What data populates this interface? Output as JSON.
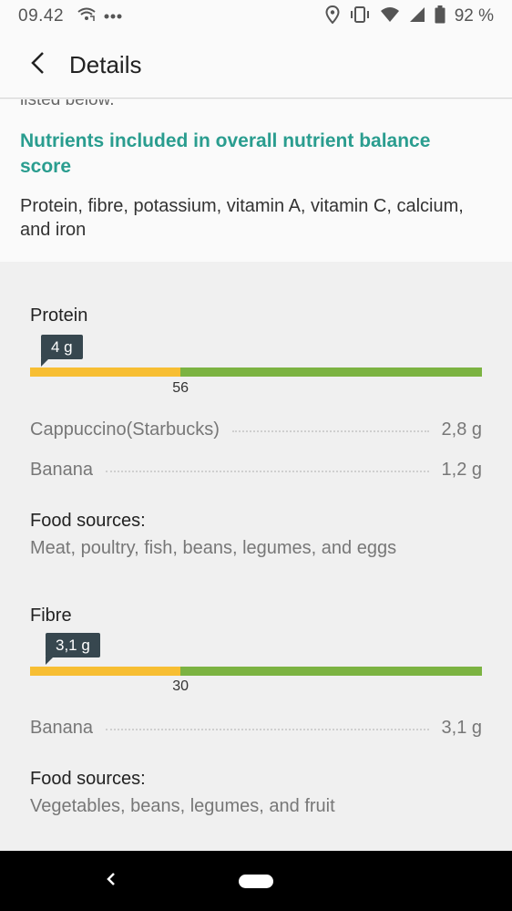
{
  "status_bar": {
    "time": "09.42",
    "battery": "92 %"
  },
  "app_bar": {
    "title": "Details"
  },
  "info": {
    "cut_text": "listed below.",
    "heading": "Nutrients included in overall nutrient balance score",
    "list": "Protein, fibre, potassium, vitamin A, vitamin C, calcium, and iron"
  },
  "nutrients": [
    {
      "name": "Protein",
      "amount": "4 g",
      "reference": "56",
      "reference_fraction": 0.333,
      "foods": [
        {
          "name": "Cappuccino(Starbucks)",
          "amount": "2,8 g"
        },
        {
          "name": "Banana",
          "amount": "1,2 g"
        }
      ],
      "sources_label": "Food sources:",
      "sources": "Meat, poultry, fish, beans, legumes, and eggs"
    },
    {
      "name": "Fibre",
      "amount": "3,1 g",
      "reference": "30",
      "reference_fraction": 0.333,
      "foods": [
        {
          "name": "Banana",
          "amount": "3,1 g"
        }
      ],
      "sources_label": "Food sources:",
      "sources": "Vegetables, beans, legumes, and fruit"
    }
  ],
  "colors": {
    "accent": "#2a9d8f",
    "bar_low": "#f7be33",
    "bar_high": "#7cb342",
    "tooltip": "#37474f"
  }
}
